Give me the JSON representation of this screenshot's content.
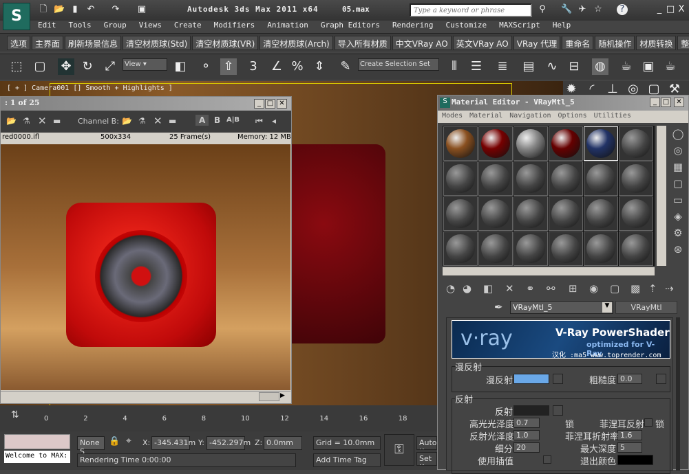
{
  "app": {
    "title": "Autodesk 3ds Max  2011 x64",
    "file": "05.max",
    "search_placeholder": "Type a keyword or phrase",
    "logo": "3ds-max-logo"
  },
  "menu": [
    "Edit",
    "Tools",
    "Group",
    "Views",
    "Create",
    "Modifiers",
    "Animation",
    "Graph Editors",
    "Rendering",
    "Customize",
    "MAXScript",
    "Help"
  ],
  "custom_toolbar": [
    "选项",
    "主界面",
    "刷新场景信息",
    "清空材质球(Std)",
    "清空材质球(VR)",
    "清空材质球(Arch)",
    "导入所有材质",
    "中文VRay AO",
    "英文VRay AO",
    "VRay 代理",
    "重命名",
    "随机操作",
    "材质转换",
    "整理手"
  ],
  "main_toolbar": {
    "ref_coord": "View",
    "selection_set": "Create Selection Set",
    "snap_3": "3",
    "snap_pct": "%"
  },
  "viewport": {
    "label": "[ + ] Camera001 [] Smooth + Highlights ]"
  },
  "frame_buffer": {
    "title": ": 1 of 25",
    "channel_b": "Channel B:",
    "btn_a": "A",
    "btn_b": "B",
    "btn_ab": "A|B",
    "file": "red0000.ifl",
    "resolution": "500x334",
    "frames": "25 Frame(s)",
    "memory": "Memory: 12 MB"
  },
  "material_editor": {
    "title": "Material Editor - VRayMtl_5",
    "menu": [
      "Modes",
      "Material",
      "Navigation",
      "Options",
      "Utilities"
    ],
    "material_name": "VRayMtl_5",
    "material_type": "VRayMtl",
    "banner": {
      "logo": "v·ray",
      "title": "V-Ray PowerShader",
      "subtitle": "optimized for V-Ray",
      "credit": "汉化 :ma5 www.toprender.com"
    },
    "diffuse": {
      "group": "漫反射",
      "label": "漫反射",
      "color": "#6aa8e8",
      "roughness_label": "粗糙度",
      "roughness": "0.0"
    },
    "reflection": {
      "group": "反射",
      "label": "反射",
      "color": "#222222",
      "hilight_label": "高光光泽度",
      "hilight": "0.7",
      "lock": "锁",
      "fresnel_label": "菲涅耳反射",
      "fresnel_lock": "锁",
      "gloss_label": "反射光泽度",
      "gloss": "1.0",
      "fresnel_ior_label": "菲涅耳折射率",
      "fresnel_ior": "1.6",
      "subdivs_label": "细分",
      "subdivs": "20",
      "max_depth_label": "最大深度",
      "max_depth": "5",
      "interp_label": "使用插值",
      "exit_label": "退出颜色",
      "exit_color": "#000000"
    }
  },
  "timeline": {
    "ticks": [
      "0",
      "2",
      "4",
      "6",
      "8",
      "10",
      "12",
      "14",
      "16",
      "18"
    ]
  },
  "status": {
    "welcome": "Welcome to MAX:",
    "selection": "None S",
    "x_label": "X:",
    "x": "-345.431m",
    "y_label": "Y:",
    "y": "-452.297m",
    "z_label": "Z:",
    "z": "0.0mm",
    "grid": "Grid = 10.0mm",
    "rendering_time": "Rendering Time  0:00:00",
    "add_time_tag": "Add Time Tag",
    "auto_key": "Auto K",
    "set_key": "Set K"
  }
}
